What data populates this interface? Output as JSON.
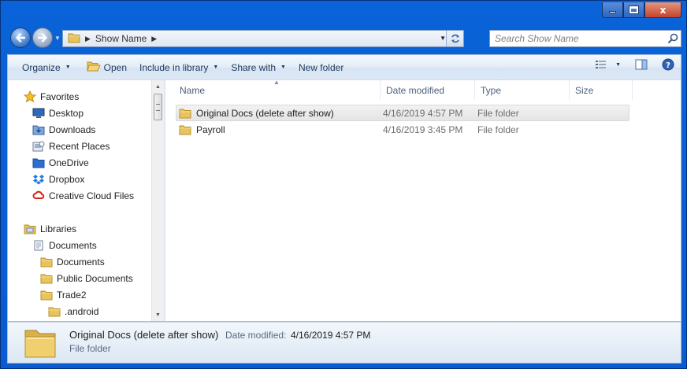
{
  "window": {
    "caption": {
      "minimize_label": "",
      "maximize_label": "",
      "close_label": "x"
    }
  },
  "address_bar": {
    "crumbs": [
      "Show Name"
    ],
    "search_placeholder": "Search Show Name"
  },
  "toolbar": {
    "organize_label": "Organize",
    "open_label": "Open",
    "include_library_label": "Include in library",
    "share_with_label": "Share with",
    "new_folder_label": "New folder"
  },
  "navigation": {
    "favorites_label": "Favorites",
    "favorites": [
      {
        "label": "Desktop",
        "icon": "desktop-icon"
      },
      {
        "label": "Downloads",
        "icon": "downloads-icon"
      },
      {
        "label": "Recent Places",
        "icon": "recent-places-icon"
      },
      {
        "label": "OneDrive",
        "icon": "onedrive-icon"
      },
      {
        "label": "Dropbox",
        "icon": "dropbox-icon"
      },
      {
        "label": "Creative Cloud Files",
        "icon": "creative-cloud-icon"
      }
    ],
    "libraries_label": "Libraries",
    "documents_label": "Documents",
    "documents_children": [
      "Documents",
      "Public Documents",
      "Trade2"
    ],
    "trade2_children": [
      ".android"
    ]
  },
  "columns": {
    "name": "Name",
    "date_modified": "Date modified",
    "type": "Type",
    "size": "Size"
  },
  "files": [
    {
      "name": "Original Docs (delete after show)",
      "date": "4/16/2019 4:57 PM",
      "type": "File folder",
      "selected": true
    },
    {
      "name": "Payroll",
      "date": "4/16/2019 3:45 PM",
      "type": "File folder",
      "selected": false
    }
  ],
  "details": {
    "name": "Original Docs (delete after show)",
    "date_label": "Date modified:",
    "date_value": "4/16/2019 4:57 PM",
    "type": "File folder"
  },
  "colors": {
    "frame": "#0a5bd0",
    "selection": "#e5e5e5",
    "folder": "#e8c45c"
  }
}
